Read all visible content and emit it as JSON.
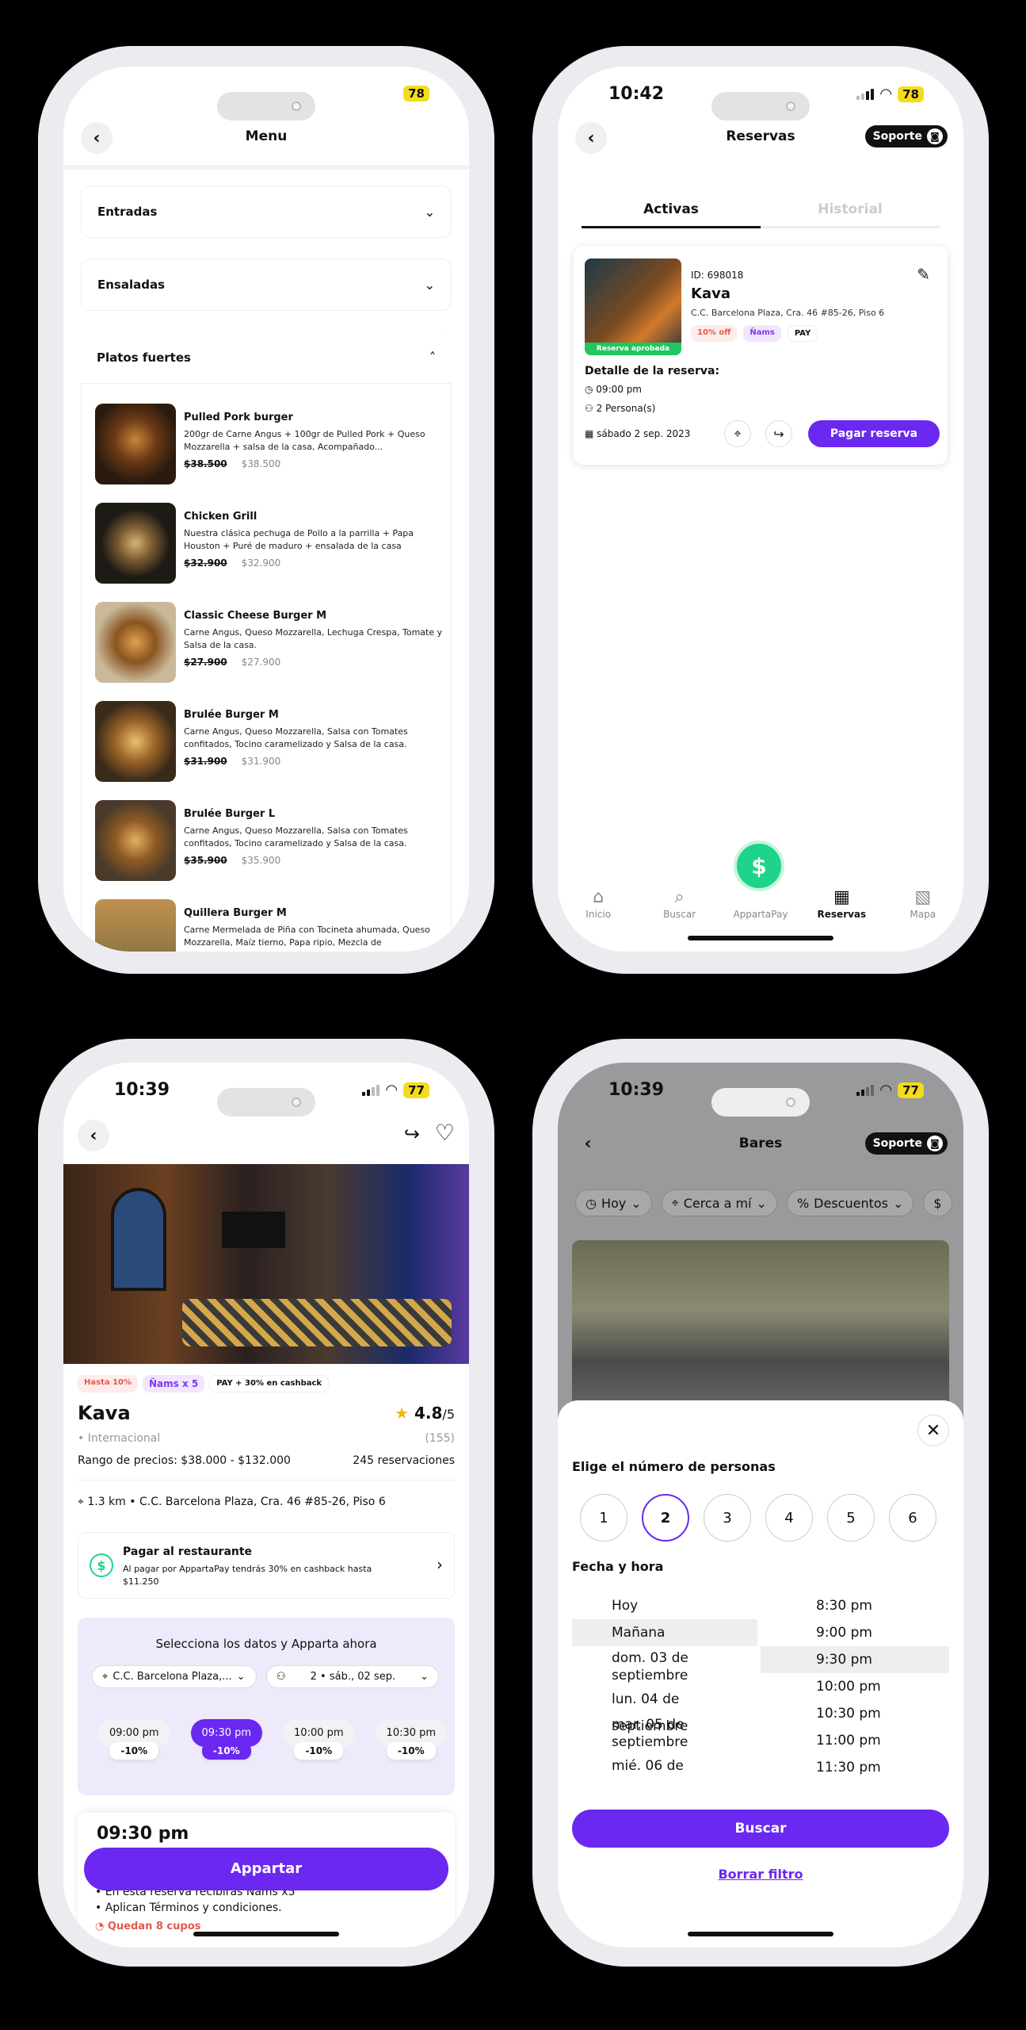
{
  "menu_screen": {
    "battery": "78",
    "title": "Menu",
    "sections": [
      "Entradas",
      "Ensaladas",
      "Platos fuertes"
    ],
    "dishes": [
      {
        "name": "Pulled Pork burger",
        "desc": "200gr de Carne Angus + 100gr de Pulled Pork + Queso Mozzarella + salsa de la casa, Acompañado...",
        "old": "$38.500",
        "price": "$38.500"
      },
      {
        "name": "Chicken Grill",
        "desc": "Nuestra clásica pechuga de Pollo a la parrilla + Papa Houston + Puré de maduro + ensalada de la casa",
        "old": "$32.900",
        "price": "$32.900"
      },
      {
        "name": "Classic Cheese Burger M",
        "desc": "Carne Angus, Queso Mozzarella, Lechuga Crespa, Tomate y Salsa de la casa.",
        "old": "$27.900",
        "price": "$27.900"
      },
      {
        "name": "Brulée Burger M",
        "desc": "Carne Angus, Queso Mozzarella, Salsa con Tomates confitados, Tocino caramelizado y Salsa de la casa.",
        "old": "$31.900",
        "price": "$31.900"
      },
      {
        "name": "Brulée Burger L",
        "desc": "Carne Angus, Queso Mozzarella, Salsa con Tomates confitados, Tocino caramelizado y Salsa de la casa.",
        "old": "$35.900",
        "price": "$35.900"
      },
      {
        "name": "Quillera Burger M",
        "desc": "Carne Mermelada de Piña con Tocineta ahumada, Queso Mozzarella, Maíz tierno, Papa ripio, Mezcla de",
        "old": "",
        "price": ""
      }
    ]
  },
  "reservas_screen": {
    "time": "10:42",
    "battery": "78",
    "title": "Reservas",
    "support": "Soporte",
    "tabs": [
      "Activas",
      "Historial"
    ],
    "card": {
      "id": "ID: 698018",
      "name": "Kava",
      "address": "C.C. Barcelona Plaza, Cra. 46 #85-26, Piso 6",
      "approved": "Reserva aprobada",
      "off": "10% off",
      "nams": "Ñams",
      "pay": "PAY",
      "detail_label": "Detalle de la reserva:",
      "hour": "09:00 pm",
      "people": "2 Persona(s)",
      "date": "sábado 2 sep. 2023",
      "pay_button": "Pagar reserva"
    },
    "nav": [
      "Inicio",
      "Buscar",
      "AppartaPay",
      "Reservas",
      "Mapa"
    ]
  },
  "detail_screen": {
    "time": "10:39",
    "battery": "77",
    "badges": {
      "discount": "Hasta 10%",
      "nams": "Ñams x 5",
      "pay": "PAY + 30% en cashback"
    },
    "name": "Kava",
    "rating": "4.8",
    "rating_max": "/5",
    "category": "• Internacional",
    "reviews": "(155)",
    "price_range": "Rango de precios: $38.000 - $132.000",
    "reservations": "245 reservaciones",
    "location": "1.3 km • C.C. Barcelona Plaza, Cra. 46 #85-26, Piso 6",
    "pay_title": "Pagar al restaurante",
    "pay_desc": "Al pagar por AppartaPay tendrás 30% en cashback hasta $11.250",
    "select_title": "Selecciona los datos y Apparta ahora",
    "branch": "C.C. Barcelona Plaza,...",
    "date_sel": "2 • sáb., 02 sep.",
    "slots": [
      {
        "t": "09:00 pm",
        "d": "-10%"
      },
      {
        "t": "09:30 pm",
        "d": "-10%"
      },
      {
        "t": "10:00 pm",
        "d": "-10%"
      },
      {
        "t": "10:30 pm",
        "d": "-10%"
      }
    ],
    "selected_time": "09:30 pm",
    "cta": "Appartar",
    "line1": "• En esta reserva recibirás Ñams x5",
    "line2": "• Aplican Términos y condiciones.",
    "remaining": "Quedan 8 cupos"
  },
  "filter_screen": {
    "time": "10:39",
    "battery": "77",
    "title": "Bares",
    "support": "Soporte",
    "chips": [
      "Hoy",
      "Cerca a mí",
      "Descuentos"
    ],
    "people_title": "Elige el número de personas",
    "people": [
      "1",
      "2",
      "3",
      "4",
      "5",
      "6"
    ],
    "datetime_title": "Fecha y hora",
    "dates": [
      "Hoy",
      "Mañana",
      "dom. 03 de septiembre",
      "lun. 04 de septiembre",
      "mar. 05 de septiembre",
      "mié. 06 de"
    ],
    "times": [
      "8:30 pm",
      "9:00 pm",
      "9:30 pm",
      "10:00 pm",
      "10:30 pm",
      "11:00 pm",
      "11:30 pm"
    ],
    "search": "Buscar",
    "clear": "Borrar filtro"
  }
}
